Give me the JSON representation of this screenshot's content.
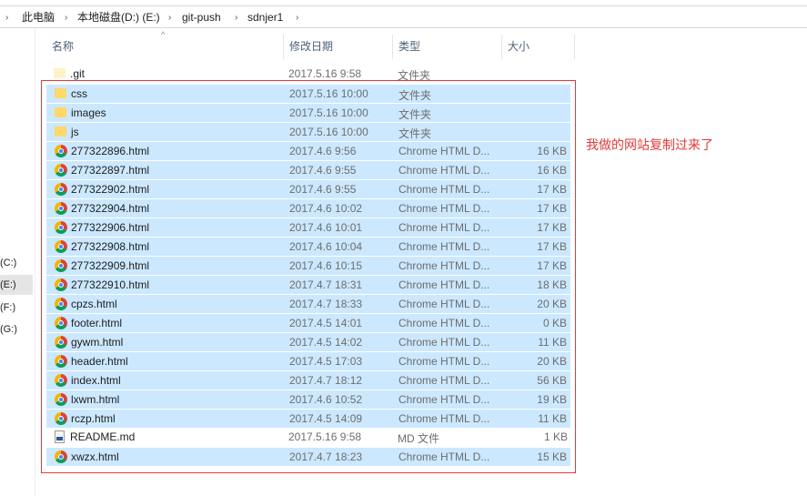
{
  "breadcrumb": [
    "此电脑",
    "本地磁盘(D:) (E:)",
    "git-push",
    "sdnjer1"
  ],
  "nav": {
    "drives": [
      "(C:)",
      "(E:)",
      "(F:)",
      "(G:)"
    ]
  },
  "columns": {
    "name": "名称",
    "date": "修改日期",
    "type": "类型",
    "size": "大小"
  },
  "files": [
    {
      "name": ".git",
      "date": "2017.5.16 9:58",
      "type": "文件夹",
      "size": "",
      "icon": "folder-icon",
      "selected": false
    },
    {
      "name": "css",
      "date": "2017.5.16 10:00",
      "type": "文件夹",
      "size": "",
      "icon": "folder-icon",
      "selected": true
    },
    {
      "name": "images",
      "date": "2017.5.16 10:00",
      "type": "文件夹",
      "size": "",
      "icon": "folder-icon",
      "selected": true
    },
    {
      "name": "js",
      "date": "2017.5.16 10:00",
      "type": "文件夹",
      "size": "",
      "icon": "folder-icon",
      "selected": true
    },
    {
      "name": "277322896.html",
      "date": "2017.4.6 9:56",
      "type": "Chrome HTML D...",
      "size": "16 KB",
      "icon": "chrome-icon",
      "selected": true
    },
    {
      "name": "277322897.html",
      "date": "2017.4.6 9:55",
      "type": "Chrome HTML D...",
      "size": "16 KB",
      "icon": "chrome-icon",
      "selected": true
    },
    {
      "name": "277322902.html",
      "date": "2017.4.6 9:55",
      "type": "Chrome HTML D...",
      "size": "17 KB",
      "icon": "chrome-icon",
      "selected": true
    },
    {
      "name": "277322904.html",
      "date": "2017.4.6 10:02",
      "type": "Chrome HTML D...",
      "size": "17 KB",
      "icon": "chrome-icon",
      "selected": true
    },
    {
      "name": "277322906.html",
      "date": "2017.4.6 10:01",
      "type": "Chrome HTML D...",
      "size": "17 KB",
      "icon": "chrome-icon",
      "selected": true
    },
    {
      "name": "277322908.html",
      "date": "2017.4.6 10:04",
      "type": "Chrome HTML D...",
      "size": "17 KB",
      "icon": "chrome-icon",
      "selected": true
    },
    {
      "name": "277322909.html",
      "date": "2017.4.6 10:15",
      "type": "Chrome HTML D...",
      "size": "17 KB",
      "icon": "chrome-icon",
      "selected": true
    },
    {
      "name": "277322910.html",
      "date": "2017.4.7 18:31",
      "type": "Chrome HTML D...",
      "size": "18 KB",
      "icon": "chrome-icon",
      "selected": true
    },
    {
      "name": "cpzs.html",
      "date": "2017.4.7 18:33",
      "type": "Chrome HTML D...",
      "size": "20 KB",
      "icon": "chrome-icon",
      "selected": true
    },
    {
      "name": "footer.html",
      "date": "2017.4.5 14:01",
      "type": "Chrome HTML D...",
      "size": "0 KB",
      "icon": "chrome-icon",
      "selected": true
    },
    {
      "name": "gywm.html",
      "date": "2017.4.5 14:02",
      "type": "Chrome HTML D...",
      "size": "11 KB",
      "icon": "chrome-icon",
      "selected": true
    },
    {
      "name": "header.html",
      "date": "2017.4.5 17:03",
      "type": "Chrome HTML D...",
      "size": "20 KB",
      "icon": "chrome-icon",
      "selected": true
    },
    {
      "name": "index.html",
      "date": "2017.4.7 18:12",
      "type": "Chrome HTML D...",
      "size": "56 KB",
      "icon": "chrome-icon",
      "selected": true
    },
    {
      "name": "lxwm.html",
      "date": "2017.4.6 10:52",
      "type": "Chrome HTML D...",
      "size": "19 KB",
      "icon": "chrome-icon",
      "selected": true
    },
    {
      "name": "rczp.html",
      "date": "2017.4.5 14:09",
      "type": "Chrome HTML D...",
      "size": "11 KB",
      "icon": "chrome-icon",
      "selected": true
    },
    {
      "name": "README.md",
      "date": "2017.5.16 9:58",
      "type": "MD 文件",
      "size": "1 KB",
      "icon": "markdown-file-icon",
      "selected": false
    },
    {
      "name": "xwzx.html",
      "date": "2017.4.7 18:23",
      "type": "Chrome HTML D...",
      "size": "15 KB",
      "icon": "chrome-icon",
      "selected": true
    }
  ],
  "annotation": {
    "text": "我做的网站复制过来了",
    "color": "#e03a3a"
  },
  "colors": {
    "selection": "#cce8ff",
    "header_text": "#4c607a"
  }
}
